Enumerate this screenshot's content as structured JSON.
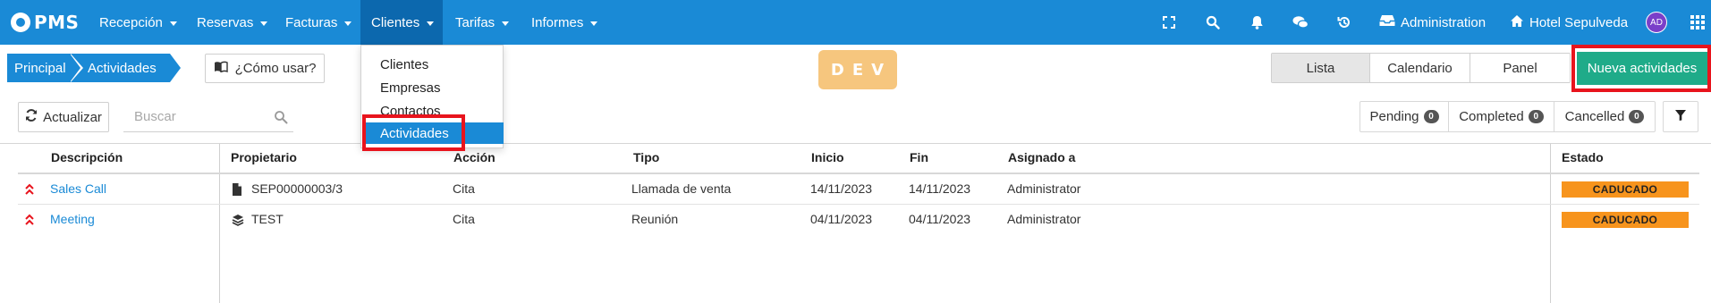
{
  "nav": {
    "logo": "PMS",
    "menus": [
      {
        "label": "Recepción"
      },
      {
        "label": "Reservas"
      },
      {
        "label": "Facturas"
      },
      {
        "label": "Clientes"
      },
      {
        "label": "Tarifas"
      },
      {
        "label": "Informes"
      }
    ],
    "admin_label": "Administration",
    "hotel_label": "Hotel Sepulveda",
    "avatar_initials": "AD",
    "icons": [
      "fullscreen-icon",
      "search-icon",
      "bell-icon",
      "chat-icon",
      "history-icon",
      "inbox-icon",
      "home-icon",
      "apps-grid-icon"
    ]
  },
  "clientes_dropdown": {
    "items": [
      "Clientes",
      "Empresas",
      "Contactos",
      "Actividades"
    ],
    "selected": "Actividades"
  },
  "breadcrumb": [
    "Principal",
    "Actividades"
  ],
  "howto_label": "¿Cómo usar?",
  "env_badge": "DEV",
  "view_tabs": [
    {
      "label": "Lista",
      "selected": true
    },
    {
      "label": "Calendario",
      "selected": false
    },
    {
      "label": "Panel",
      "selected": false
    }
  ],
  "new_button_label": "Nueva actividades",
  "toolbar": {
    "refresh_label": "Actualizar",
    "search_placeholder": "Buscar",
    "status_filters": [
      {
        "label": "Pending",
        "count": "0"
      },
      {
        "label": "Completed",
        "count": "0"
      },
      {
        "label": "Cancelled",
        "count": "0"
      }
    ]
  },
  "table": {
    "columns": [
      "Descripción",
      "Propietario",
      "Acción",
      "Tipo",
      "Inicio",
      "Fin",
      "Asignado a",
      "Estado"
    ],
    "rows": [
      {
        "descripcion": "Sales Call",
        "propietario": "SEP00000003/3",
        "owner_icon": "document-icon",
        "accion": "Cita",
        "tipo": "Llamada de venta",
        "inicio": "14/11/2023",
        "fin": "14/11/2023",
        "asignado": "Administrator",
        "estado": "CADUCADO"
      },
      {
        "descripcion": "Meeting",
        "propietario": "TEST",
        "owner_icon": "layers-icon",
        "accion": "Cita",
        "tipo": "Reunión",
        "inicio": "04/11/2023",
        "fin": "04/11/2023",
        "asignado": "Administrator",
        "estado": "CADUCADO"
      }
    ]
  },
  "colors": {
    "nav_bg": "#1a8ad6",
    "nav_active": "#0c68ae",
    "primary_button": "#1fab89",
    "status_expired": "#f7941d",
    "dev_badge": "#f6c67e",
    "highlight_outline": "#e8141d",
    "link": "#1a8ad6",
    "priority_arrow": "#e8141d"
  }
}
